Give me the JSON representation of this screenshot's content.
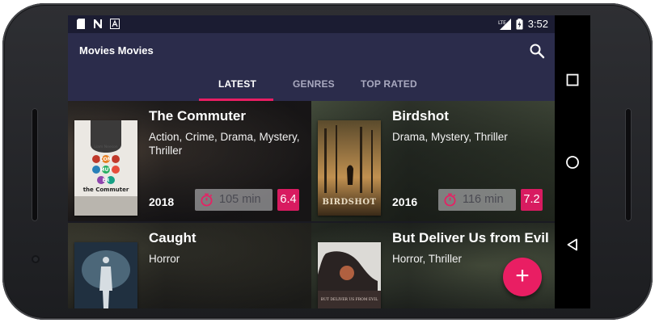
{
  "status_bar": {
    "time": "3:52",
    "left_icons": [
      "sd-card-icon",
      "n-app-icon",
      "a-app-icon"
    ],
    "right_icons": [
      "lte-signal-icon",
      "battery-icon"
    ]
  },
  "app_bar": {
    "title": "Movies Movies",
    "search_icon": "search-icon"
  },
  "tabs": [
    {
      "label": "LATEST",
      "active": true
    },
    {
      "label": "GENRES",
      "active": false
    },
    {
      "label": "TOP RATED",
      "active": false
    }
  ],
  "movies": [
    {
      "title": "The Commuter",
      "genres": "Action, Crime, Drama, Mystery, Thriller",
      "year": "2018",
      "runtime": "105 min",
      "rating": "6.4",
      "poster_lines": [
        "Liam Neeson",
        "COM",
        "MUT",
        "ER",
        "the Commuter"
      ]
    },
    {
      "title": "Birdshot",
      "genres": "Drama, Mystery, Thriller",
      "year": "2016",
      "runtime": "116 min",
      "rating": "7.2",
      "poster_lines": [
        "BIRDSHOT"
      ]
    },
    {
      "title": "Caught",
      "genres": "Horror"
    },
    {
      "title": "But Deliver Us from Evil",
      "genres": "Horror, Thriller",
      "poster_lines": [
        "BUT DELIVER US FROM EVIL"
      ]
    }
  ],
  "fab": {
    "label": "+"
  },
  "colors": {
    "status_bar": "#1b1c32",
    "app_bar": "#2b2c4b",
    "accent": "#e91e63",
    "rating_badge": "#d81b60"
  },
  "nav_bar": {
    "icons": [
      "recents-square-icon",
      "home-circle-icon",
      "back-triangle-icon"
    ]
  }
}
